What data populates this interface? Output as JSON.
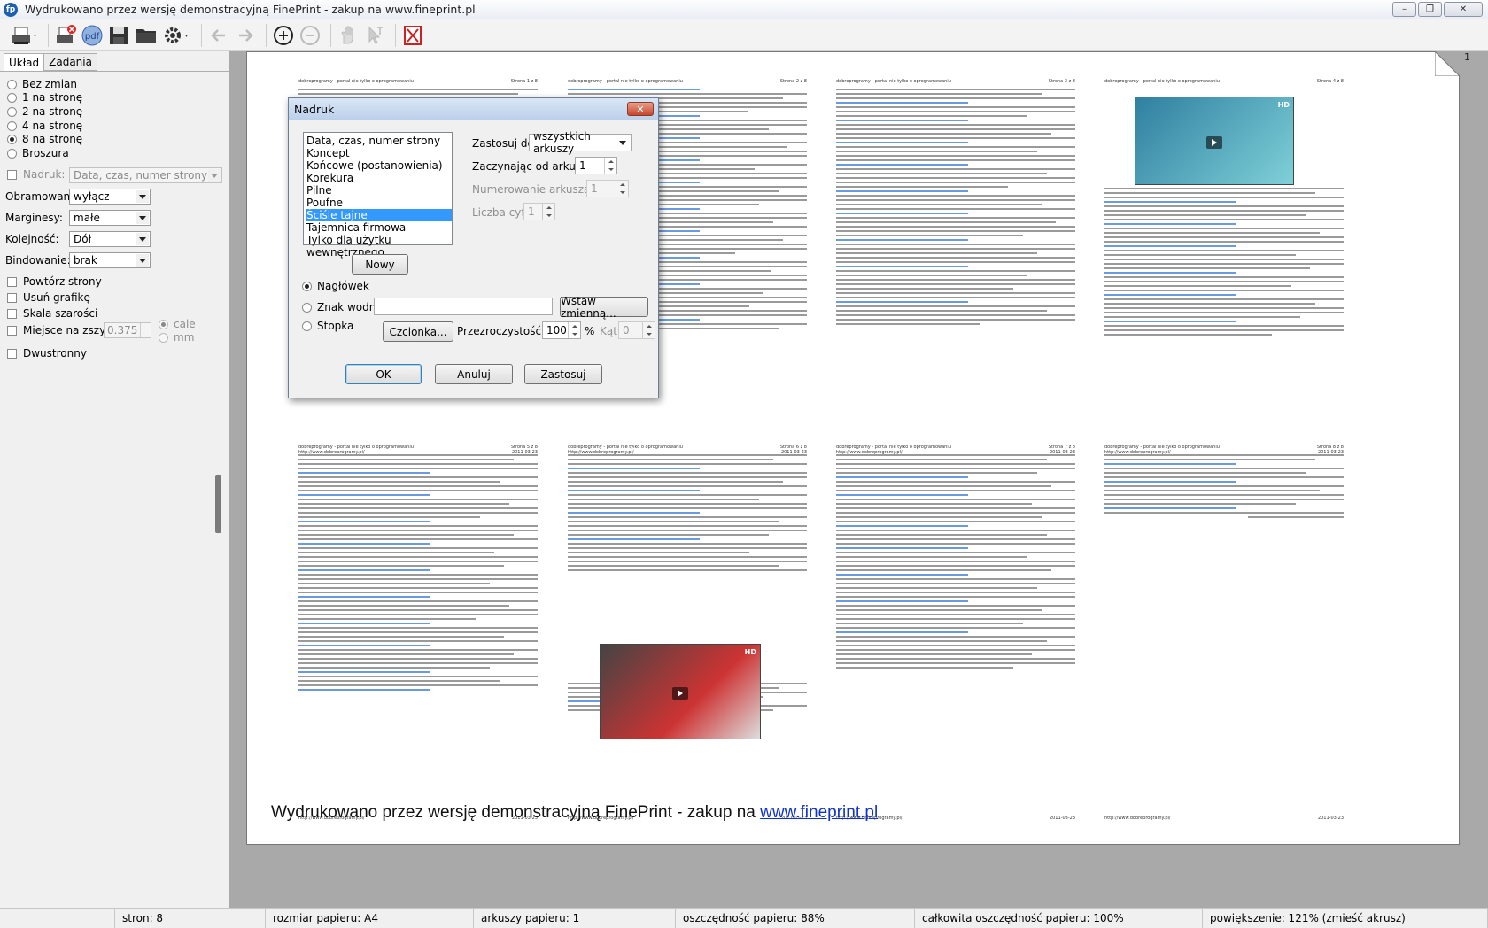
{
  "window": {
    "title": "Wydrukowano przez wersję demonstracyjną FinePrint - zakup na www.fineprint.pl",
    "app_icon": "fineprint-icon"
  },
  "toolbar": {
    "icons": [
      "printer-icon",
      "delete-print-icon",
      "pdf-icon",
      "save-icon",
      "folder-icon",
      "gear-icon",
      "arrow-left-icon",
      "arrow-right-icon",
      "zoom-in-icon",
      "zoom-out-icon",
      "hand-icon",
      "select-icon",
      "cancel-icon"
    ],
    "pdf_label": "pdf"
  },
  "sidebar": {
    "tabs": [
      "Układ",
      "Zadania"
    ],
    "layout_options": [
      "Bez zmian",
      "1 na stronę",
      "2 na stronę",
      "4 na stronę",
      "8 na stronę",
      "Broszura"
    ],
    "selected_layout": "8 na stronę",
    "nadruk_label": "Nadruk:",
    "nadruk_value": "Data, czas, numer strony",
    "obramowanie_label": "Obramowanie:",
    "obramowanie_value": "wyłącz",
    "marginesy_label": "Marginesy:",
    "marginesy_value": "małe",
    "kolejnosc_label": "Kolejność:",
    "kolejnosc_value": "Dół",
    "bindowanie_label": "Bindowanie:",
    "bindowanie_value": "brak",
    "powtorz": "Powtórz strony",
    "usun": "Usuń grafikę",
    "skala": "Skala szarości",
    "miejsce": "Miejsce na zszycie",
    "miejsce_value": "0.375",
    "unit_cale": "cale",
    "unit_mm": "mm",
    "dwustronny": "Dwustronny"
  },
  "preview": {
    "page_number": "1",
    "header_left": "dobreprogramy - portal nie tylko o oprogramowaniu",
    "page_labels": [
      "Strona 1 z 8",
      "Strona 2 z 8",
      "Strona 3 z 8",
      "Strona 4 z 8",
      "Strona 5 z 8",
      "Strona 6 z 8",
      "Strona 7 z 8",
      "Strona 8 z 8"
    ],
    "footer_left": "http://www.dobreprogramy.pl/",
    "footer_right": "2011-03-23",
    "watermark_text": "Wydrukowano przez wersję demonstracyjną FinePrint - zakup na ",
    "watermark_link": "www.fineprint.pl",
    "video_hd": "HD"
  },
  "dialog": {
    "title": "Nadruk",
    "list": [
      "Data, czas, numer strony",
      "Koncept",
      "Końcowe (postanowienia)",
      "Korekura",
      "Pilne",
      "Poufne",
      "Ściśle tajne",
      "Tajemnica firmowa",
      "Tylko dla użytku wewnętrznego"
    ],
    "selected": "Ściśle tajne",
    "nowy": "Nowy",
    "zastosuj_do_label": "Zastosuj do:",
    "zastosuj_do_value": "wszystkich arkuszy",
    "zaczynajac_label": "Zaczynając od arkusza",
    "zaczynajac_value": "1",
    "numerowanie_label": "Numerowanie arkusza od:",
    "numerowanie_value": "1",
    "liczba_label": "Liczba cyfr:",
    "liczba_value": "1",
    "naglowek": "Nagłówek",
    "znak_wodny": "Znak wodny",
    "stopka": "Stopka",
    "wstaw": "Wstaw zmienną...",
    "czcionka": "Czcionka...",
    "przezroczystosc_label": "Przezroczystość:",
    "przezroczystosc_value": "100",
    "percent": "%",
    "kat_label": "Kąt:",
    "kat_value": "0",
    "ok": "OK",
    "anuluj": "Anuluj",
    "zastosuj": "Zastosuj"
  },
  "status": {
    "stron": "stron: 8",
    "rozmiar": "rozmiar papieru: A4",
    "arkusze": "arkuszy papieru: 1",
    "oszczednosc": "oszczędność papieru: 88%",
    "calkowita": "całkowita oszczędność papieru: 100%",
    "powiekszenie": "powiększenie: 121% (zmieść akrusz)"
  }
}
